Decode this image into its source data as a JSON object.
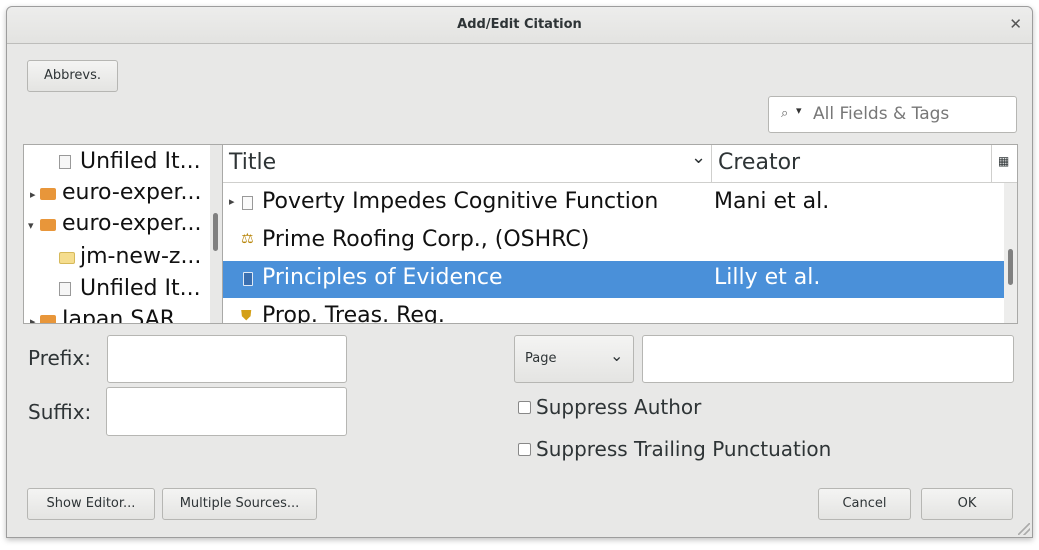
{
  "window": {
    "title": "Add/Edit Citation",
    "close_glyph": "✕"
  },
  "toolbar": {
    "abbrevs_label": "Abbrevs."
  },
  "search": {
    "placeholder": "All Fields & Tags",
    "icon": "search-icon",
    "dropdown_glyph": "▾"
  },
  "collections": [
    {
      "label": "Unfiled It...",
      "icon": "pages-icon",
      "expander": ""
    },
    {
      "label": "euro-exper...",
      "icon": "folder-icon",
      "expander": "▸"
    },
    {
      "label": "euro-exper...",
      "icon": "folder-icon",
      "expander": "▾"
    },
    {
      "label": "jm-new-z...",
      "icon": "folder-light-icon",
      "expander": ""
    },
    {
      "label": "Unfiled It...",
      "icon": "pages-icon",
      "expander": ""
    },
    {
      "label": "Japan SAR...",
      "icon": "folder-icon",
      "expander": "▸"
    }
  ],
  "items_table": {
    "columns": {
      "title": "Title",
      "title_sort_glyph": "⌄",
      "creator": "Creator",
      "picker_glyph": "▦"
    },
    "rows": [
      {
        "title": "Poverty Impedes Cognitive Function",
        "creator": "Mani et al.",
        "icon": "document-icon",
        "expander": "▸",
        "selected": false
      },
      {
        "title": "Prime Roofing Corp., (OSHRC)",
        "creator": "",
        "icon": "scales-icon",
        "expander": "",
        "selected": false
      },
      {
        "title": "Principles of Evidence",
        "creator": "Lilly et al.",
        "icon": "book-icon",
        "expander": "",
        "selected": true
      },
      {
        "title": "Prop. Treas. Reg.",
        "creator": "",
        "icon": "shield-icon",
        "expander": "",
        "selected": false
      }
    ]
  },
  "form": {
    "prefix_label": "Prefix:",
    "suffix_label": "Suffix:",
    "locator_type": "Page",
    "locator_glyph": "⌄",
    "suppress_author_label": "Suppress Author",
    "suppress_trailing_label": "Suppress Trailing Punctuation"
  },
  "footer": {
    "show_editor_label": "Show Editor...",
    "multiple_sources_label": "Multiple Sources...",
    "cancel_label": "Cancel",
    "ok_label": "OK"
  },
  "colors": {
    "selection": "#4a90d9",
    "folder": "#e8963a"
  }
}
